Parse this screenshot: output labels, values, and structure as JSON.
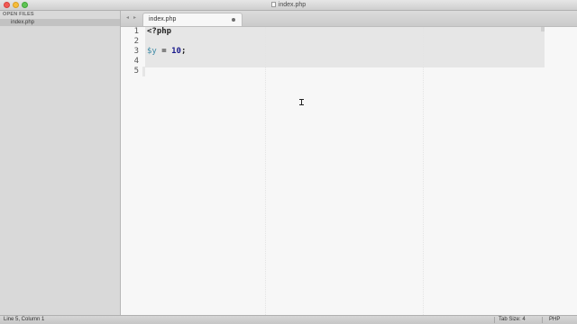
{
  "window": {
    "title": "index.php"
  },
  "sidebar": {
    "header": "OPEN FILES",
    "files": [
      {
        "name": "index.php",
        "selected": true
      }
    ]
  },
  "tabs": [
    {
      "label": "index.php",
      "active": true
    }
  ],
  "editor": {
    "line_numbers": [
      "1",
      "2",
      "3",
      "4",
      "5"
    ],
    "lines": [
      {
        "segments": [
          {
            "text": "<?php",
            "type": "plain"
          }
        ]
      },
      {
        "segments": []
      },
      {
        "segments": [
          {
            "text": "$y",
            "type": "var"
          },
          {
            "text": " = ",
            "type": "plain"
          },
          {
            "text": "10",
            "type": "num"
          },
          {
            "text": ";",
            "type": "plain"
          }
        ]
      },
      {
        "segments": []
      },
      {
        "segments": []
      }
    ],
    "current_line": 5
  },
  "statusbar": {
    "position": "Line 5, Column 1",
    "tab_size": "Tab Size: 4",
    "syntax": "PHP"
  },
  "colors": {
    "editor_bg": "#f7f7f7",
    "variable": "#3f8ba6",
    "number": "#1a1a8c"
  }
}
